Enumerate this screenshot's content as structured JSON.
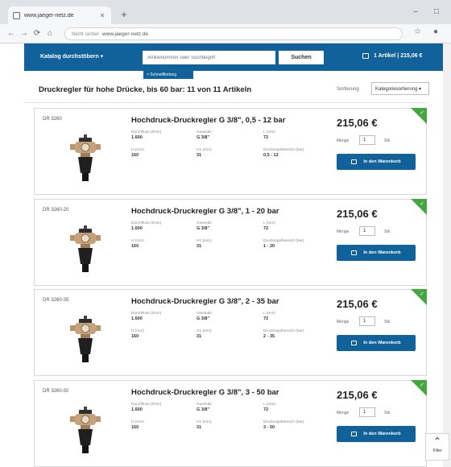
{
  "browser": {
    "tab_title": "www.jaeger-netz.de",
    "tab_close": "×",
    "new_tab": "+",
    "url_security": "Nicht sicher",
    "url": "www.jaeger-netz.de",
    "window_controls": [
      "–",
      "□"
    ]
  },
  "header": {
    "catalog_label": "Katalog durchstöbern ▾",
    "search_placeholder": "Artikelnummer oder Suchbegriff",
    "search_button": "Suchen",
    "cart_info": "1 Artikel | 215,06 €",
    "filter_chip": "× Schnellfindung",
    "brand_color": "#11619b"
  },
  "page": {
    "title": "Druckregler für hohe Drücke, bis 60 bar: 11 von 11 Artikeln",
    "sort_label": "Sortierung",
    "sort_value": "Kategoriesortierung ▾"
  },
  "products": [
    {
      "sku": "DR 3260",
      "title": "Hochdruck-Druckregler G 3/8\", 0,5 - 12 bar",
      "specs": [
        {
          "label": "Durchfluss (l/min)",
          "value": "1.600"
        },
        {
          "label": "Gewinde",
          "value": "G 3/8\""
        },
        {
          "label": "L (mm)",
          "value": "72"
        },
        {
          "label": "H (mm)",
          "value": "160"
        },
        {
          "label": "H1 (mm)",
          "value": "31"
        },
        {
          "label": "Druckregelbereich (bar)",
          "value": "0,5 - 12"
        }
      ],
      "price": "215,06 €",
      "qty_label": "Menge",
      "qty": "1",
      "unit": "Stk",
      "add_button": "In den Warenkorb"
    },
    {
      "sku": "DR 3260-20",
      "title": "Hochdruck-Druckregler G 3/8\", 1 - 20 bar",
      "specs": [
        {
          "label": "Durchfluss (l/min)",
          "value": "1.600"
        },
        {
          "label": "Gewinde",
          "value": "G 3/8\""
        },
        {
          "label": "L (mm)",
          "value": "72"
        },
        {
          "label": "H (mm)",
          "value": "160"
        },
        {
          "label": "H1 (mm)",
          "value": "31"
        },
        {
          "label": "Druckregelbereich (bar)",
          "value": "1 - 20"
        }
      ],
      "price": "215,06 €",
      "qty_label": "Menge",
      "qty": "1",
      "unit": "Stk",
      "add_button": "In den Warenkorb"
    },
    {
      "sku": "DR 3260-35",
      "title": "Hochdruck-Druckregler G 3/8\", 2 - 35 bar",
      "specs": [
        {
          "label": "Durchfluss (l/min)",
          "value": "1.600"
        },
        {
          "label": "Gewinde",
          "value": "G 3/8\""
        },
        {
          "label": "L (mm)",
          "value": "72"
        },
        {
          "label": "H (mm)",
          "value": "160"
        },
        {
          "label": "H1 (mm)",
          "value": "31"
        },
        {
          "label": "Druckregelbereich (bar)",
          "value": "2 - 35"
        }
      ],
      "price": "215,06 €",
      "qty_label": "Menge",
      "qty": "1",
      "unit": "Stk",
      "add_button": "In den Warenkorb"
    },
    {
      "sku": "DR 3260-50",
      "title": "Hochdruck-Druckregler G 3/8\", 3 - 50 bar",
      "specs": [
        {
          "label": "Durchfluss (l/min)",
          "value": "1.600"
        },
        {
          "label": "Gewinde",
          "value": "G 3/8\""
        },
        {
          "label": "L (mm)",
          "value": "72"
        },
        {
          "label": "H (mm)",
          "value": "160"
        },
        {
          "label": "H1 (mm)",
          "value": "31"
        },
        {
          "label": "Druckregelbereich (bar)",
          "value": "3 - 50"
        }
      ],
      "price": "215,06 €",
      "qty_label": "Menge",
      "qty": "1",
      "unit": "Stk",
      "add_button": "In den Warenkorb"
    }
  ],
  "filter_button": {
    "icon": "chevron-up-icon",
    "label": "Filter"
  }
}
